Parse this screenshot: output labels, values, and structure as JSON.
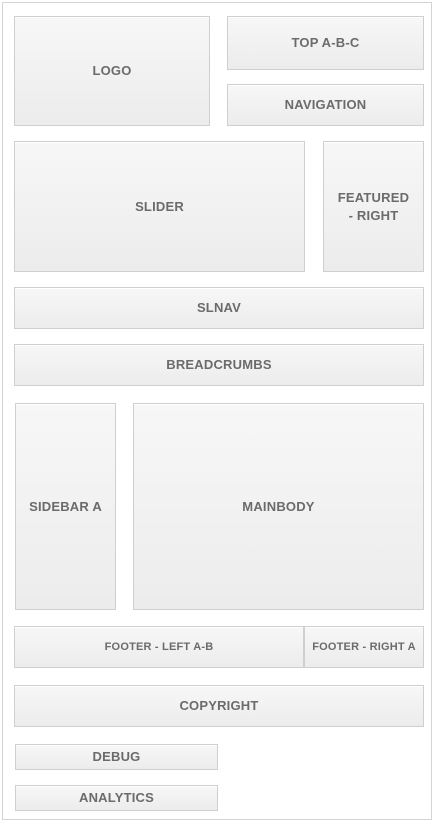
{
  "blocks": {
    "logo": "LOGO",
    "top": "TOP A-B-C",
    "navigation": "NAVIGATION",
    "slider": "SLIDER",
    "featured": "FEATURED\n- RIGHT",
    "slnav": "SLNAV",
    "breadcrumbs": "BREADCRUMBS",
    "sidebar": "SIDEBAR A",
    "mainbody": "MAINBODY",
    "footer_left": "FOOTER - LEFT A-B",
    "footer_right": "FOOTER - RIGHT A",
    "copyright": "COPYRIGHT",
    "debug": "DEBUG",
    "analytics": "ANALYTICS"
  }
}
